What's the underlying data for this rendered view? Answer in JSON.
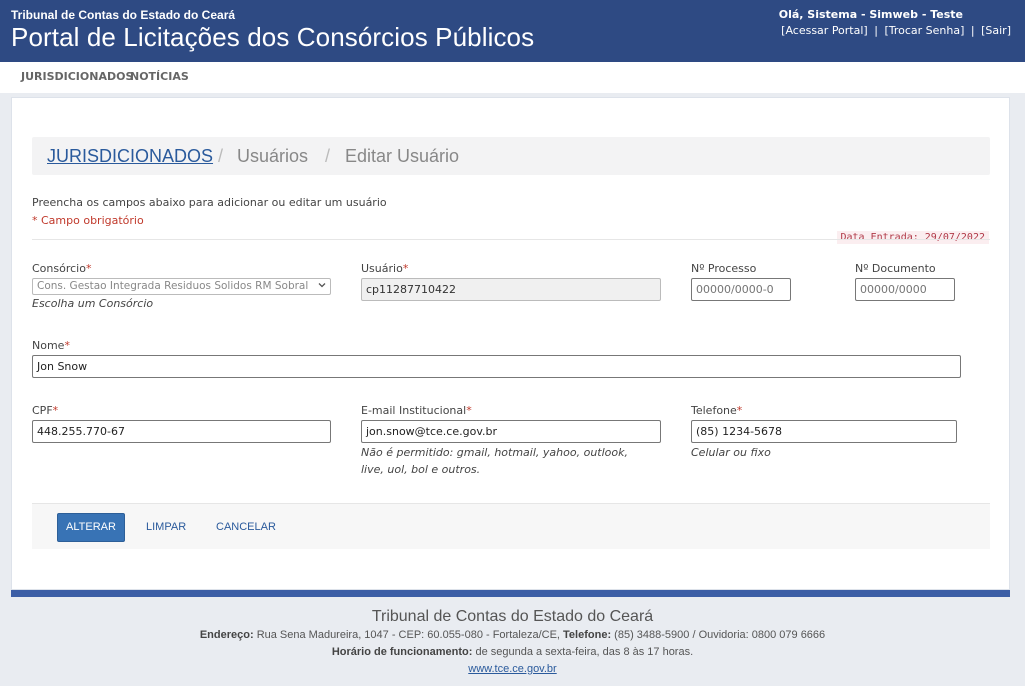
{
  "header": {
    "org": "Tribunal de Contas do Estado do Ceará",
    "title": "Portal de Licitações dos Consórcios Públicos",
    "greeting": "Olá, Sistema - Simweb - Teste",
    "links": {
      "acessar": "[Acessar Portal]",
      "trocar": "[Trocar Senha]",
      "sair": "[Sair]",
      "separator": "|"
    }
  },
  "nav": {
    "items": [
      "JURISDICIONADOS",
      "NOTÍCIAS"
    ]
  },
  "breadcrumb": {
    "root": "JURISDICIONADOS",
    "separator": "/",
    "level2": "Usuários",
    "current": "Editar Usuário"
  },
  "form": {
    "hint": "Preencha os campos abaixo para adicionar ou editar um usuário",
    "required_note": "* Campo obrigatório",
    "required_mark": "*",
    "entry_date": "Data Entrada: 29/07/2022",
    "consorcio": {
      "label": "Consórcio",
      "value": "Cons. Gestao Integrada Residuos Solidos RM Sobral",
      "help": "Escolha um Consórcio"
    },
    "usuario": {
      "label": "Usuário",
      "value": "cp11287710422"
    },
    "processo": {
      "label": "Nº Processo",
      "placeholder": "00000/0000-0"
    },
    "documento": {
      "label": "Nº Documento",
      "placeholder": "00000/0000"
    },
    "nome": {
      "label": "Nome",
      "value": "Jon Snow"
    },
    "cpf": {
      "label": "CPF",
      "value": "448.255.770-67"
    },
    "email": {
      "label": "E-mail Institucional",
      "value": "jon.snow@tce.ce.gov.br",
      "help_line1": "Não é permitido: gmail, hotmail, yahoo, outlook,",
      "help_line2": "live, uol, bol e outros."
    },
    "telefone": {
      "label": "Telefone",
      "value": "(85) 1234-5678",
      "help": "Celular ou fixo"
    }
  },
  "actions": {
    "alterar": "ALTERAR",
    "limpar": "LIMPAR",
    "cancelar": "CANCELAR"
  },
  "footer": {
    "title": "Tribunal de Contas do Estado do Ceará",
    "address_label": "Endereço:",
    "address": "Rua Sena Madureira, 1047 - CEP: 60.055-080 - Fortaleza/CE,",
    "phone_label": "Telefone:",
    "phone": "(85) 3488-5900 / Ouvidoria: 0800 079 6666",
    "hours_label": "Horário de funcionamento:",
    "hours": "de segunda a sexta-feira, das 8 às 17 horas.",
    "website": "www.tce.ce.gov.br"
  },
  "colors": {
    "header_bg": "#2e4a83",
    "primary_button": "#3873b5",
    "required": "#c0392b",
    "link": "#2a5a9c"
  }
}
